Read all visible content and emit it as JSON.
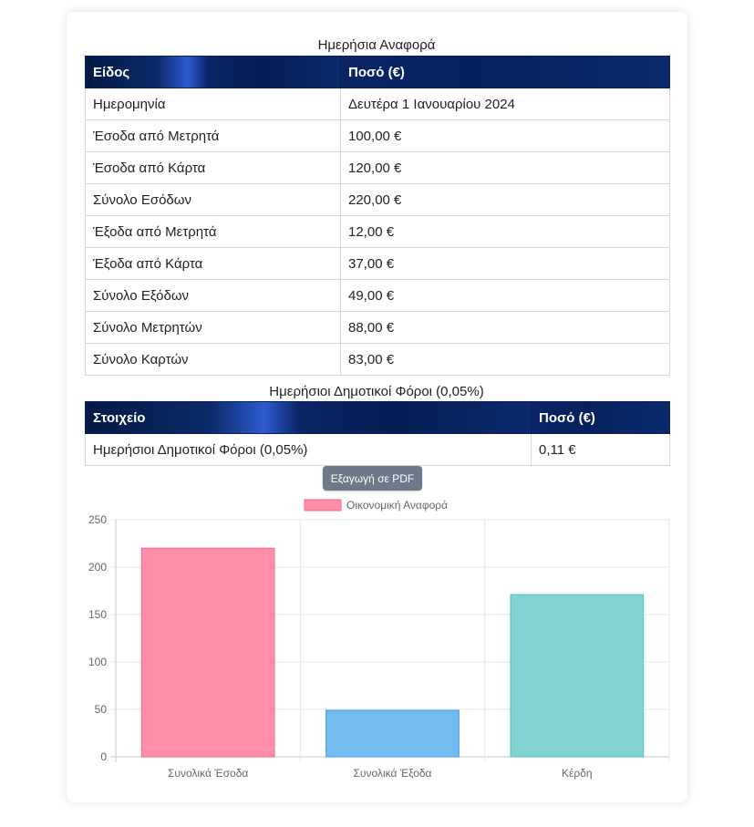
{
  "report": {
    "caption": "Ημερήσια Αναφορά",
    "headers": [
      "Είδος",
      "Ποσό (€)"
    ],
    "rows": [
      {
        "label": "Ημερομηνία",
        "value": "Δευτέρα 1 Ιανουαρίου 2024"
      },
      {
        "label": "Έσοδα από Μετρητά",
        "value": "100,00 €"
      },
      {
        "label": "Έσοδα από Κάρτα",
        "value": "120,00 €"
      },
      {
        "label": "Σύνολο Εσόδων",
        "value": "220,00 €"
      },
      {
        "label": "Έξοδα από Μετρητά",
        "value": "12,00 €"
      },
      {
        "label": "Έξοδα από Κάρτα",
        "value": "37,00 €"
      },
      {
        "label": "Σύνολο Εξόδων",
        "value": "49,00 €"
      },
      {
        "label": "Σύνολο Μετρητών",
        "value": "88,00 €"
      },
      {
        "label": "Σύνολο Καρτών",
        "value": "83,00 €"
      }
    ]
  },
  "taxes": {
    "caption": "Ημερήσιοι Δημοτικοί Φόροι (0,05%)",
    "headers": [
      "Στοιχείο",
      "Ποσό (€)"
    ],
    "rows": [
      {
        "label": "Ημερήσιοι Δημοτικοί Φόροι (0,05%)",
        "value": "0,11 €"
      }
    ]
  },
  "export_button": "Εξαγωγή σε PDF",
  "chart_data": {
    "type": "bar",
    "legend": "Οικονομική Αναφορά",
    "legend_position": "top",
    "categories": [
      "Συνολικά Έσοδα",
      "Συνολικά Έξοδα",
      "Κέρδη"
    ],
    "values": [
      220,
      49,
      171
    ],
    "bar_colors": [
      "#ff8fa8",
      "#72bcf0",
      "#82d3d2"
    ],
    "bar_borders": [
      "#ff6384",
      "#36a2eb",
      "#4bc0c0"
    ],
    "ylim": [
      0,
      250
    ],
    "yticks": [
      0,
      50,
      100,
      150,
      200,
      250
    ],
    "grid": true
  }
}
